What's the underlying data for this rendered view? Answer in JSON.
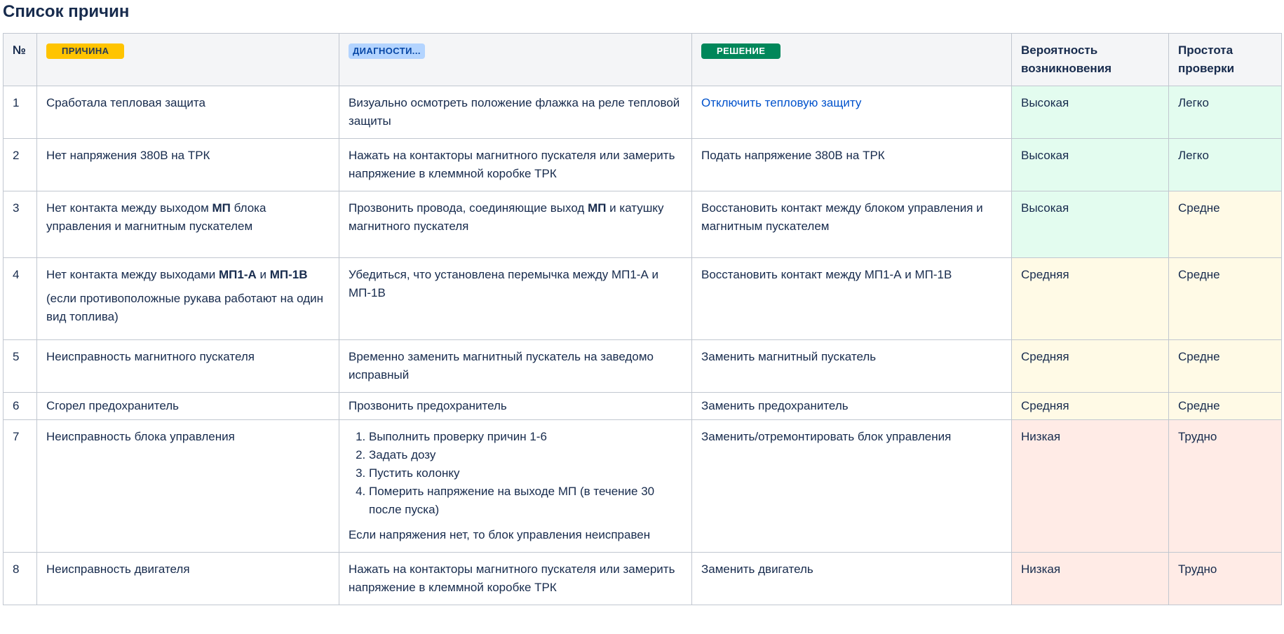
{
  "page": {
    "title": "Список причин"
  },
  "headers": {
    "num": "№",
    "cause": "ПРИЧИНА",
    "diagnostics": "ДИАГНОСТИ...",
    "solution": "РЕШЕНИЕ",
    "probability": "Вероятность возникновения",
    "ease": "Простота проверки"
  },
  "colors": {
    "high": "#e3fcef",
    "medium": "#fffae6",
    "low": "#ffebe6",
    "lozenge_cause": "#ffc400",
    "lozenge_diag": "#b3d4ff",
    "lozenge_solution": "#00875a",
    "link": "#0052cc"
  },
  "rows": [
    {
      "num": "1",
      "cause": "Сработала тепловая защита",
      "diagnostics": "Визуально осмотреть положение флажка на реле тепловой защиты",
      "solution": "Отключить тепловую защиту",
      "probability": "Высокая",
      "ease": "Легко"
    },
    {
      "num": "2",
      "cause": "Нет напряжения 380В на ТРК",
      "diagnostics": "Нажать на контакторы магнитного пускателя или замерить напряжение в клеммной коробке ТРК",
      "solution": "Подать напряжение 380В на ТРК",
      "probability": "Высокая",
      "ease": "Легко"
    },
    {
      "num": "3",
      "cause_pre": "Нет контакта между выходом ",
      "cause_bold": "МП",
      "cause_post": " блока управления и магнитным пускателем",
      "diag_pre": "Прозвонить провода, соединяющие выход ",
      "diag_bold": "МП",
      "diag_post": " и катушку магнитного пускателя",
      "solution": "Восстановить контакт между блоком управления и магнитным пускателем",
      "probability": "Высокая",
      "ease": "Средне"
    },
    {
      "num": "4",
      "cause_pre": "Нет контакта между выходами ",
      "cause_bold1": "МП1-А",
      "cause_mid": " и ",
      "cause_bold2": "МП-1В",
      "cause_note": "(если противоположные рукава работают на один вид топлива)",
      "diagnostics": "Убедиться, что установлена перемычка между МП1-А и МП-1В",
      "solution": "Восстановить контакт между МП1-А и МП-1В",
      "probability": "Средняя",
      "ease": "Средне"
    },
    {
      "num": "5",
      "cause": "Неисправность магнитного пускателя",
      "diagnostics": "Временно заменить магнитный пускатель на заведомо исправный",
      "solution": "Заменить магнитный пускатель",
      "probability": "Средняя",
      "ease": "Средне"
    },
    {
      "num": "6",
      "cause": "Сгорел предохранитель",
      "diagnostics": "Прозвонить предохранитель",
      "solution": "Заменить предохранитель",
      "probability": "Средняя",
      "ease": "Средне"
    },
    {
      "num": "7",
      "cause": "Неисправность блока управления",
      "steps": [
        "Выполнить проверку причин 1-6",
        "Задать дозу",
        "Пустить колонку",
        "Померить напряжение на выходе МП (в течение 30 после пуска)"
      ],
      "diag_after": "Если напряжения нет, то блок управления неисправен",
      "solution": "Заменить/отремонтировать блок управления",
      "probability": "Низкая",
      "ease": "Трудно"
    },
    {
      "num": "8",
      "cause": "Неисправность двигателя",
      "diagnostics": "Нажать на контакторы магнитного пускателя или замерить напряжение в клеммной коробке ТРК",
      "solution": "Заменить двигатель",
      "probability": "Низкая",
      "ease": "Трудно"
    }
  ]
}
